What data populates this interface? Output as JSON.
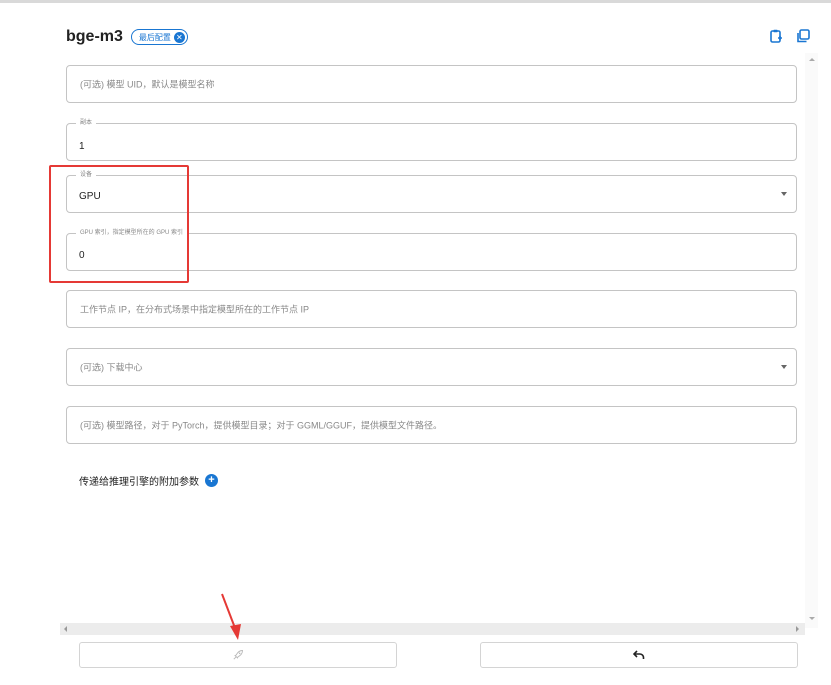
{
  "header": {
    "title": "bge-m3",
    "chip_label": "最后配置"
  },
  "fields": {
    "uid": {
      "placeholder": "(可选) 模型 UID，默认是模型名称"
    },
    "replica": {
      "label": "副本",
      "value": "1"
    },
    "device": {
      "label": "设备",
      "value": "GPU"
    },
    "gpu_idx": {
      "label": "GPU 索引，指定模型所在的 GPU 索引",
      "value": "0"
    },
    "worker_ip": {
      "placeholder": "工作节点 IP，在分布式场景中指定模型所在的工作节点 IP"
    },
    "download_hub": {
      "placeholder": "(可选) 下载中心"
    },
    "model_path": {
      "placeholder": "(可选) 模型路径，对于 PyTorch，提供模型目录；对于 GGML/GGUF，提供模型文件路径。"
    }
  },
  "extra": {
    "label": "传递给推理引擎的附加参数"
  },
  "icons": {
    "chip_close": "close-circle-icon",
    "copy_json": "paste-icon",
    "copy": "copy-icon",
    "add": "add-circle-icon",
    "launch": "rocket-icon",
    "reset": "undo-icon"
  },
  "colors": {
    "accent": "#1976d2",
    "highlight": "#e53935"
  }
}
